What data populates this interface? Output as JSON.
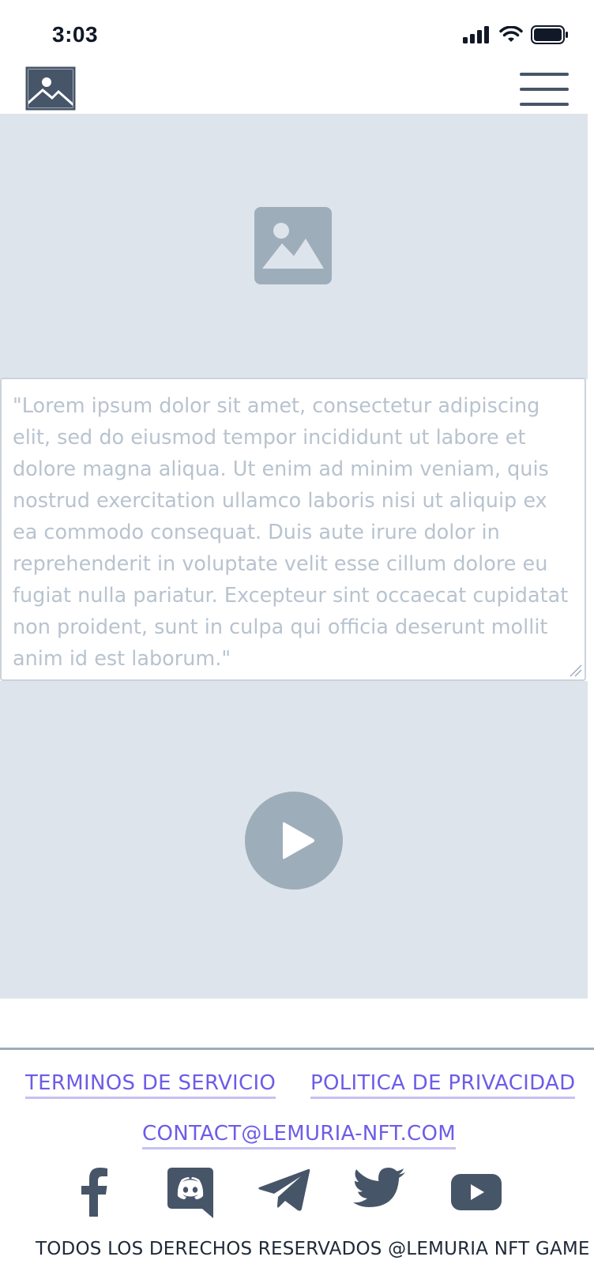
{
  "status_bar": {
    "time": "3:03"
  },
  "hero": {
    "icon": "image-placeholder-icon"
  },
  "quote": {
    "text": "\"Lorem ipsum dolor sit amet, consectetur adipiscing elit, sed do eiusmod tempor incididunt ut labore et dolore magna aliqua. Ut enim ad minim veniam, quis nostrud exercitation ullamco laboris nisi ut aliquip ex ea commodo consequat. Duis aute irure dolor in reprehenderit in voluptate velit esse cillum dolore eu fugiat nulla pariatur. Excepteur sint occaecat cupidatat non proident, sunt in culpa qui officia deserunt mollit anim id est laborum.\""
  },
  "video": {
    "icon": "play-icon"
  },
  "footer": {
    "terms_label": "TERMINOS DE SERVICIO",
    "privacy_label": "POLITICA DE PRIVACIDAD",
    "contact_label": "CONTACT@LEMURIA-NFT.COM",
    "socials": [
      "facebook-icon",
      "discord-icon",
      "telegram-icon",
      "twitter-icon",
      "youtube-icon"
    ],
    "copyright": "TODOS LOS DERECHOS RESERVADOS @LEMURIA NFT GAME"
  },
  "colors": {
    "placeholder_bg": "#dee4ec",
    "placeholder_icon": "#9eadba",
    "link": "#6d5ce8",
    "icon_dark": "#475569"
  }
}
